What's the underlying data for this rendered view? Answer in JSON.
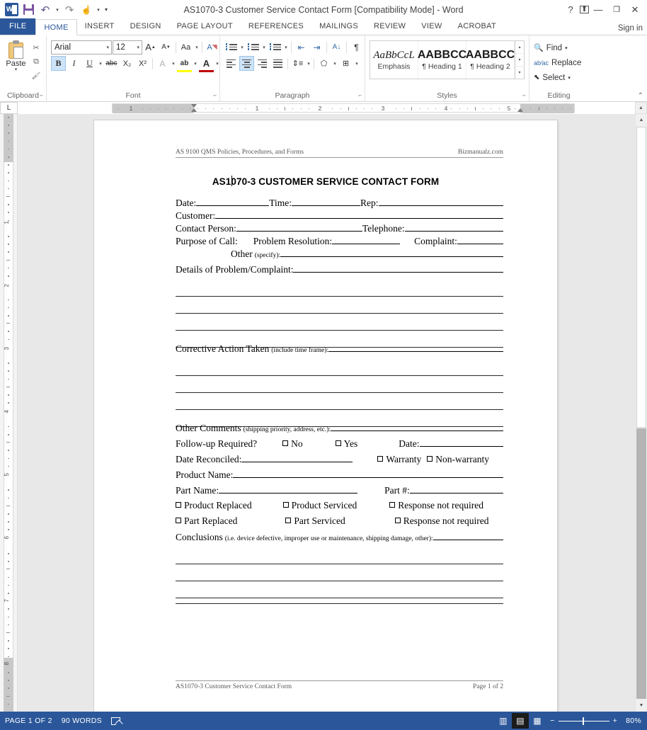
{
  "window": {
    "title": "AS1070-3 Customer Service Contact Form [Compatibility Mode] - Word",
    "quick_access": [
      {
        "name": "word-logo",
        "label": "W"
      },
      {
        "name": "save",
        "label": ""
      },
      {
        "name": "undo",
        "label": "↰"
      },
      {
        "name": "undo-dropdown",
        "label": "▾"
      },
      {
        "name": "redo",
        "label": "↻"
      },
      {
        "name": "touch-mode",
        "label": "☝"
      },
      {
        "name": "touch-dropdown",
        "label": "▾"
      },
      {
        "name": "customize-qat",
        "label": "▾"
      }
    ],
    "controls": {
      "help": "?",
      "ribbon_display": "⬆",
      "minimize": "—",
      "restore": "❐",
      "close": "✕"
    },
    "signin": "Sign in"
  },
  "tabs": [
    {
      "label": "FILE",
      "active": false,
      "file": true
    },
    {
      "label": "HOME",
      "active": true
    },
    {
      "label": "INSERT",
      "active": false
    },
    {
      "label": "DESIGN",
      "active": false
    },
    {
      "label": "PAGE LAYOUT",
      "active": false
    },
    {
      "label": "REFERENCES",
      "active": false
    },
    {
      "label": "MAILINGS",
      "active": false
    },
    {
      "label": "REVIEW",
      "active": false
    },
    {
      "label": "VIEW",
      "active": false
    },
    {
      "label": "ACROBAT",
      "active": false
    }
  ],
  "ribbon": {
    "clipboard": {
      "group_label": "Clipboard",
      "paste_label": "Paste",
      "paste_arrow": "▾",
      "cut": "✂",
      "copy": "⧉",
      "format_painter": "🖌"
    },
    "font": {
      "group_label": "Font",
      "font_name": "Arial",
      "font_size": "12",
      "grow_font": "A",
      "shrink_font": "A",
      "change_case": "Aa",
      "clear_formatting": "A",
      "bold": "B",
      "italic": "I",
      "underline": "U",
      "strikethrough": "abc",
      "subscript": "X₂",
      "superscript": "X²",
      "text_effects": "A",
      "highlight": "ab",
      "font_color": "A",
      "highlight_color": "#ffff00",
      "font_color_swatch": "#c00000"
    },
    "paragraph": {
      "group_label": "Paragraph",
      "bullets": "",
      "numbering": "",
      "multilevel": "",
      "decrease_indent": "⇤",
      "increase_indent": "⇥",
      "sort": "A↓",
      "show_marks": "¶",
      "align_left": "",
      "align_center": "",
      "align_right": "",
      "justify": "",
      "line_spacing": "",
      "shading": "",
      "borders": ""
    },
    "styles": {
      "group_label": "Styles",
      "items": [
        {
          "preview": "AaBbCcL",
          "name": "Emphasis",
          "italic": true
        },
        {
          "preview": "AABBCC",
          "name": "¶ Heading 1",
          "bold": true
        },
        {
          "preview": "AABBCC",
          "name": "¶ Heading 2",
          "bold": true
        }
      ]
    },
    "editing": {
      "group_label": "Editing",
      "find": "Find",
      "find_arrow": "▾",
      "replace": "Replace",
      "select": "Select",
      "select_arrow": "▾"
    },
    "collapse": "⌃"
  },
  "ruler": {
    "tab_selector": "L",
    "horizontal_numbers": [
      "1",
      "1",
      "2",
      "3",
      "4",
      "5"
    ],
    "vertical_numbers": [
      "1",
      "2",
      "3",
      "4",
      "5",
      "6",
      "7",
      "8"
    ]
  },
  "document": {
    "header_left": "AS 9100 QMS Policies, Procedures, and Forms",
    "header_right": "Bizmanualz.com",
    "title": "AS1070-3 CUSTOMER SERVICE CONTACT FORM",
    "fields": {
      "date": "Date:",
      "time": "Time:",
      "rep": "Rep:",
      "customer": "Customer:",
      "contact_person": "Contact Person:",
      "telephone": "Telephone:",
      "purpose_of_call": "Purpose of Call:",
      "problem_resolution": "Problem Resolution:",
      "complaint": "Complaint:",
      "other": "Other",
      "other_specify": "(specify):",
      "details": "Details of Problem/Complaint:",
      "corrective_action": "Corrective Action Taken",
      "corrective_note": "(include time frame):",
      "other_comments": "Other Comments",
      "other_comments_note": "(shipping priority, address, etc.):",
      "follow_up": "Follow-up Required?",
      "follow_no": "No",
      "follow_yes": "Yes",
      "follow_date": "Date:",
      "date_reconciled": "Date Reconciled:",
      "warranty": "Warranty",
      "non_warranty": "Non-warranty",
      "product_name": "Product Name:",
      "part_name": "Part Name:",
      "part_number": "Part #:",
      "product_replaced": "Product Replaced",
      "product_serviced": "Product Serviced",
      "response_not_required_1": "Response not required",
      "part_replaced": "Part Replaced",
      "part_serviced": "Part Serviced",
      "response_not_required_2": "Response not required",
      "conclusions": "Conclusions",
      "conclusions_note": "(i.e. device defective, improper use or maintenance, shipping damage, other):"
    },
    "footer_left": "AS1070-3 Customer Service Contact Form",
    "footer_right": "Page 1 of 2"
  },
  "status_bar": {
    "page": "PAGE 1 OF 2",
    "words": "90 WORDS",
    "proofing": "proofing-icon",
    "views": [
      {
        "name": "read-mode",
        "selected": false
      },
      {
        "name": "print-layout",
        "selected": true
      },
      {
        "name": "web-layout",
        "selected": false
      }
    ],
    "zoom_out": "−",
    "zoom_in": "+",
    "zoom_level": "80%",
    "accent_color": "#2b579a"
  }
}
